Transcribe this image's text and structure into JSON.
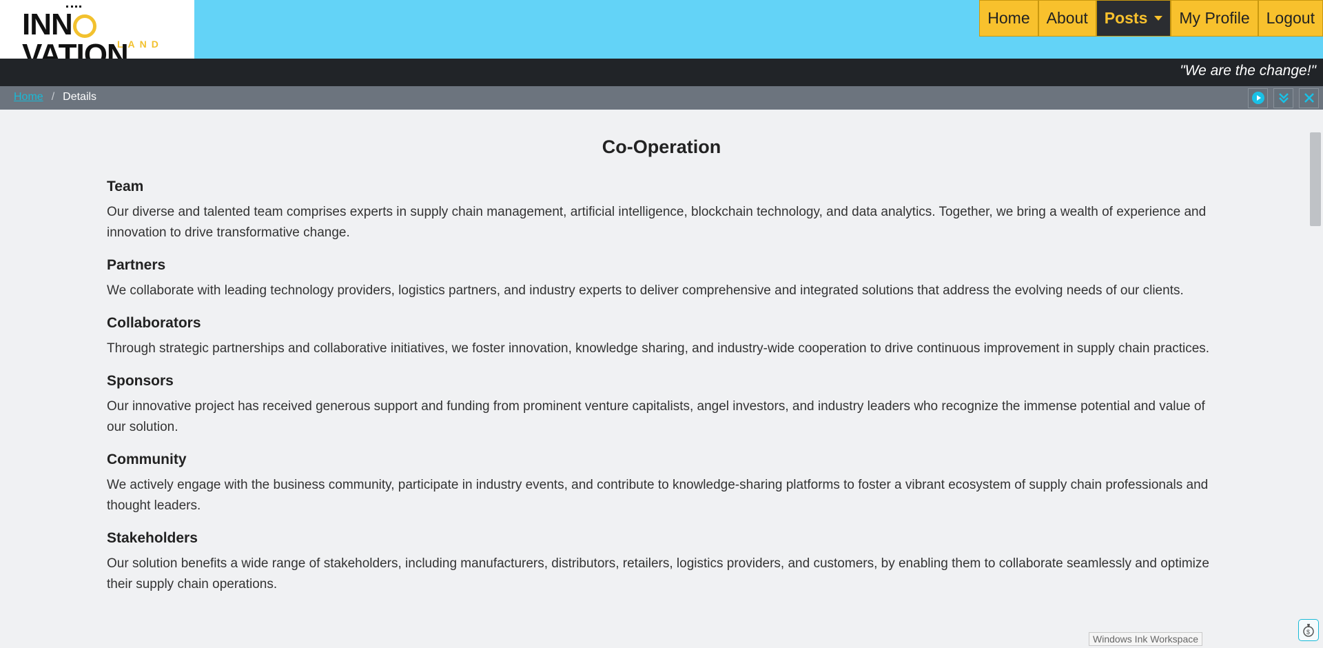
{
  "brand": {
    "name_part1": "INN",
    "name_part2": "VATION",
    "sub": "LAND"
  },
  "nav": {
    "items": [
      {
        "label": "Home"
      },
      {
        "label": "About"
      },
      {
        "label": "Posts"
      },
      {
        "label": "My Profile"
      },
      {
        "label": "Logout"
      }
    ]
  },
  "quote": "\"We are the change!\"",
  "breadcrumb": {
    "home": "Home",
    "separator": "/",
    "current": "Details"
  },
  "page": {
    "title": "Co-Operation",
    "sections": [
      {
        "title": "Team",
        "body": "Our diverse and talented team comprises experts in supply chain management, artificial intelligence, blockchain technology, and data analytics. Together, we bring a wealth of experience and innovation to drive transformative change."
      },
      {
        "title": "Partners",
        "body": "We collaborate with leading technology providers, logistics partners, and industry experts to deliver comprehensive and integrated solutions that address the evolving needs of our clients."
      },
      {
        "title": "Collaborators",
        "body": "Through strategic partnerships and collaborative initiatives, we foster innovation, knowledge sharing, and industry-wide cooperation to drive continuous improvement in supply chain practices."
      },
      {
        "title": "Sponsors",
        "body": "Our innovative project has received generous support and funding from prominent venture capitalists, angel investors, and industry leaders who recognize the immense potential and value of our solution."
      },
      {
        "title": "Community",
        "body": "We actively engage with the business community, participate in industry events, and contribute to knowledge-sharing platforms to foster a vibrant ecosystem of supply chain professionals and thought leaders."
      },
      {
        "title": "Stakeholders",
        "body": "Our solution benefits a wide range of stakeholders, including manufacturers, distributors, retailers, logistics providers, and customers, by enabling them to collaborate seamlessly and optimize their supply chain operations."
      }
    ]
  },
  "tooltip": "Windows Ink Workspace",
  "colors": {
    "header": "#63d3f7",
    "nav_button": "#f8c12d",
    "accent": "#19c1e6",
    "quote_bar": "#212428",
    "breadcrumb_bar": "#6c747e"
  },
  "icons": {
    "play": "play-icon",
    "expand": "chevrons-down-icon",
    "close": "close-icon",
    "ink": "pen-icon"
  }
}
